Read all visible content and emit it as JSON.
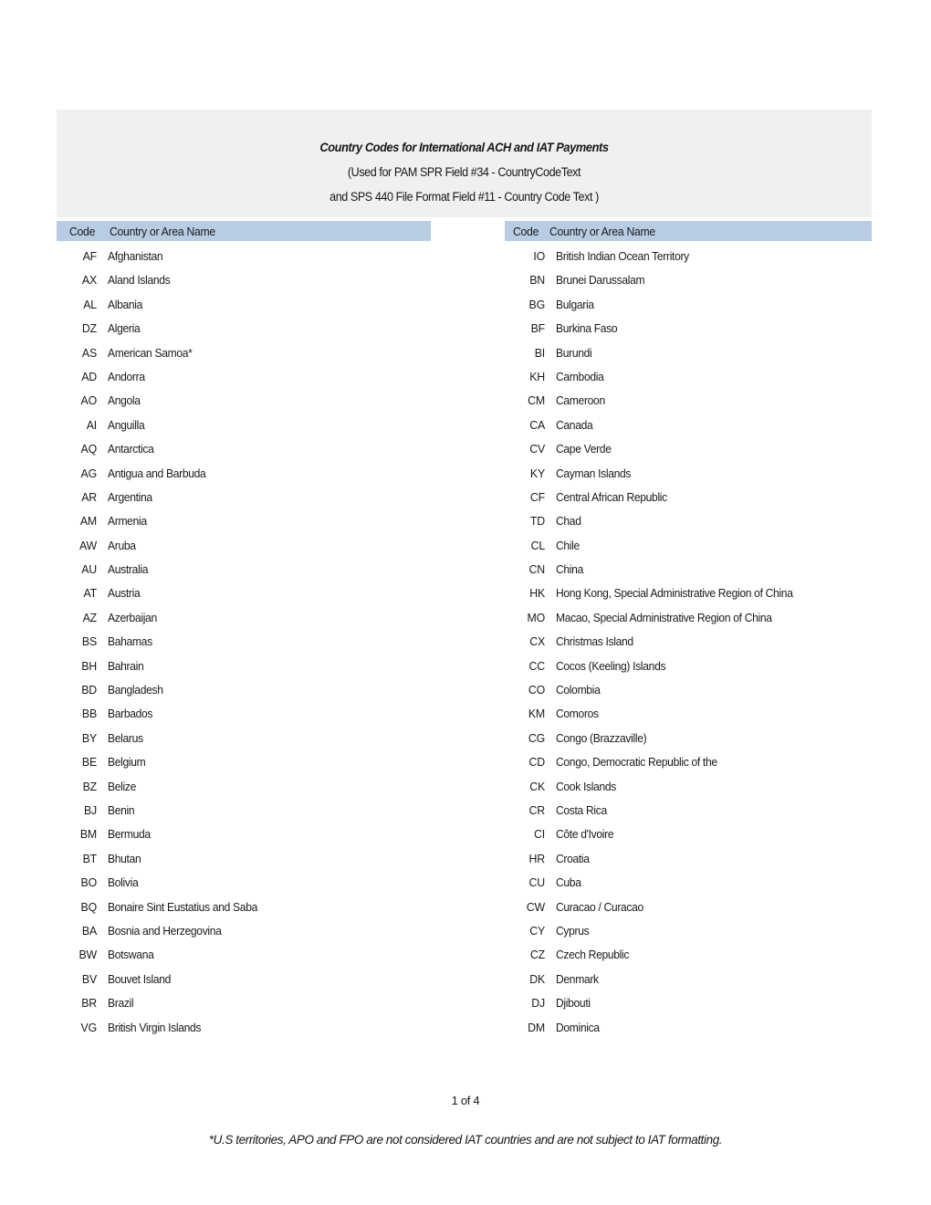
{
  "document": {
    "title_lines": [
      "Country Codes for International ACH and IAT Payments",
      "(Used for PAM SPR Field #34 - CountryCodeText",
      "and SPS 440 File Format Field #11 - Country Code Text )"
    ],
    "page_number": "1 of 4",
    "footnote": "*U.S territories, APO and FPO are not considered IAT countries and are not subject to IAT formatting."
  },
  "colors": {
    "title_block_background": "#f0f0f0",
    "header_band_background": "#b8cce4",
    "text": "#1a1a1a",
    "page_background": "#ffffff"
  },
  "table": {
    "headers": {
      "code": "Code",
      "name": "Country or Area Name"
    },
    "left_column": [
      {
        "code": "AF",
        "name": "Afghanistan"
      },
      {
        "code": "AX",
        "name": "Aland Islands"
      },
      {
        "code": "AL",
        "name": "Albania"
      },
      {
        "code": "DZ",
        "name": "Algeria"
      },
      {
        "code": "AS",
        "name": "American Samoa*"
      },
      {
        "code": "AD",
        "name": "Andorra"
      },
      {
        "code": "AO",
        "name": "Angola"
      },
      {
        "code": "AI",
        "name": "Anguilla"
      },
      {
        "code": "AQ",
        "name": "Antarctica"
      },
      {
        "code": "AG",
        "name": "Antigua and Barbuda"
      },
      {
        "code": "AR",
        "name": "Argentina"
      },
      {
        "code": "AM",
        "name": "Armenia"
      },
      {
        "code": "AW",
        "name": "Aruba"
      },
      {
        "code": "AU",
        "name": "Australia"
      },
      {
        "code": "AT",
        "name": "Austria"
      },
      {
        "code": "AZ",
        "name": "Azerbaijan"
      },
      {
        "code": "BS",
        "name": "Bahamas"
      },
      {
        "code": "BH",
        "name": "Bahrain"
      },
      {
        "code": "BD",
        "name": "Bangladesh"
      },
      {
        "code": "BB",
        "name": "Barbados"
      },
      {
        "code": "BY",
        "name": "Belarus"
      },
      {
        "code": "BE",
        "name": "Belgium"
      },
      {
        "code": "BZ",
        "name": "Belize"
      },
      {
        "code": "BJ",
        "name": "Benin"
      },
      {
        "code": "BM",
        "name": "Bermuda"
      },
      {
        "code": "BT",
        "name": "Bhutan"
      },
      {
        "code": "BO",
        "name": "Bolivia"
      },
      {
        "code": "BQ",
        "name": "Bonaire Sint Eustatius and Saba"
      },
      {
        "code": "BA",
        "name": "Bosnia and Herzegovina"
      },
      {
        "code": "BW",
        "name": "Botswana"
      },
      {
        "code": "BV",
        "name": "Bouvet Island"
      },
      {
        "code": "BR",
        "name": "Brazil"
      },
      {
        "code": "VG",
        "name": "British Virgin Islands"
      }
    ],
    "right_column": [
      {
        "code": "IO",
        "name": "British Indian Ocean Territory"
      },
      {
        "code": "BN",
        "name": "Brunei Darussalam"
      },
      {
        "code": "BG",
        "name": "Bulgaria"
      },
      {
        "code": "BF",
        "name": "Burkina Faso"
      },
      {
        "code": "BI",
        "name": "Burundi"
      },
      {
        "code": "KH",
        "name": "Cambodia"
      },
      {
        "code": "CM",
        "name": "Cameroon"
      },
      {
        "code": "CA",
        "name": "Canada"
      },
      {
        "code": "CV",
        "name": "Cape Verde"
      },
      {
        "code": "KY",
        "name": "Cayman Islands"
      },
      {
        "code": "CF",
        "name": "Central African Republic"
      },
      {
        "code": "TD",
        "name": "Chad"
      },
      {
        "code": "CL",
        "name": "Chile"
      },
      {
        "code": "CN",
        "name": "China"
      },
      {
        "code": "HK",
        "name": "Hong Kong, Special Administrative Region of China"
      },
      {
        "code": "MO",
        "name": "Macao, Special Administrative Region of China"
      },
      {
        "code": "CX",
        "name": "Christmas Island"
      },
      {
        "code": "CC",
        "name": "Cocos (Keeling) Islands"
      },
      {
        "code": "CO",
        "name": "Colombia"
      },
      {
        "code": "KM",
        "name": "Comoros"
      },
      {
        "code": "CG",
        "name": "Congo (Brazzaville)"
      },
      {
        "code": "CD",
        "name": "Congo, Democratic Republic of the"
      },
      {
        "code": "CK",
        "name": "Cook Islands"
      },
      {
        "code": "CR",
        "name": "Costa Rica"
      },
      {
        "code": "CI",
        "name": "Côte d'Ivoire"
      },
      {
        "code": "HR",
        "name": "Croatia"
      },
      {
        "code": "CU",
        "name": "Cuba"
      },
      {
        "code": "CW",
        "name": "Curacao / Curacao"
      },
      {
        "code": "CY",
        "name": "Cyprus"
      },
      {
        "code": "CZ",
        "name": "Czech Republic"
      },
      {
        "code": "DK",
        "name": "Denmark"
      },
      {
        "code": "DJ",
        "name": "Djibouti"
      },
      {
        "code": "DM",
        "name": "Dominica"
      }
    ]
  }
}
